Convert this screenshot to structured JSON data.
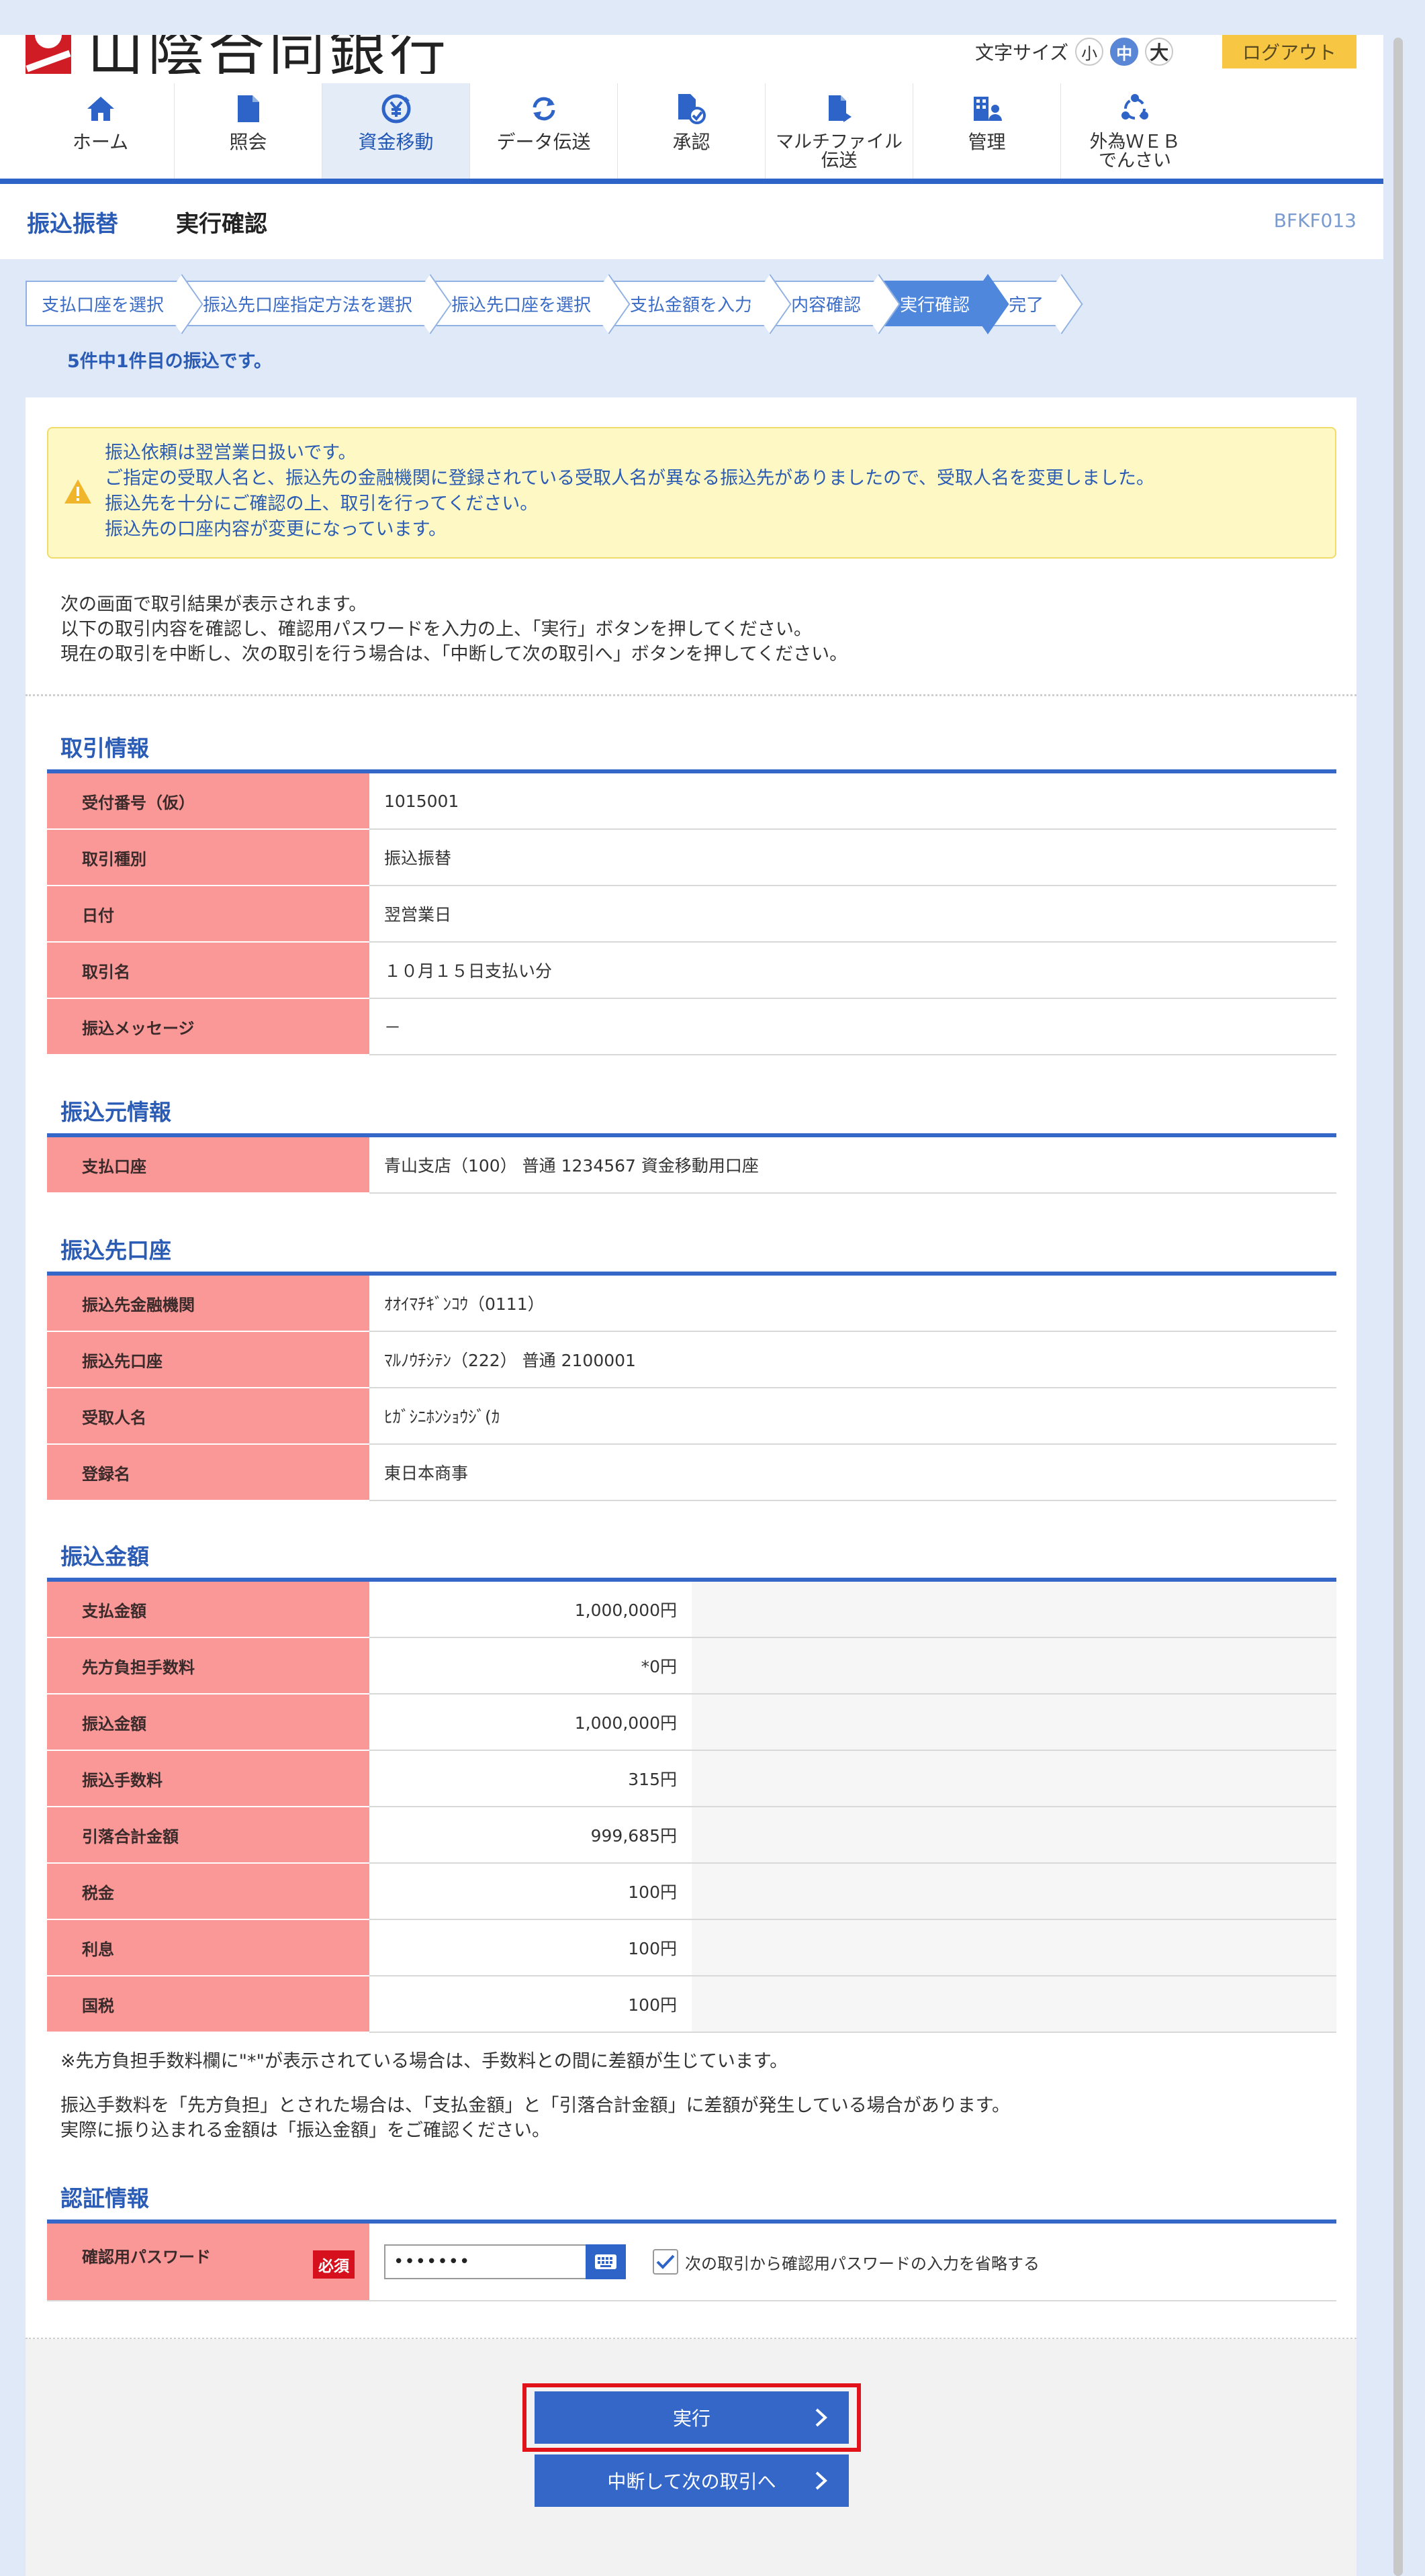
{
  "header": {
    "logo_text": "山陰合同銀行",
    "font_size_label": "文字サイズ",
    "font_sizes": [
      "小",
      "中",
      "大"
    ],
    "logout": "ログアウト"
  },
  "nav": [
    {
      "label": "ホーム",
      "icon": "home-icon"
    },
    {
      "label": "照会",
      "icon": "document-icon"
    },
    {
      "label": "資金移動",
      "icon": "yen-transfer-icon"
    },
    {
      "label": "データ伝送",
      "icon": "refresh-icon"
    },
    {
      "label": "承認",
      "icon": "approval-icon"
    },
    {
      "label": "マルチファイル\n伝送",
      "icon": "multi-file-icon"
    },
    {
      "label": "管理",
      "icon": "manage-icon"
    },
    {
      "label": "外為ＷＥＢ\nでんさい",
      "icon": "network-icon"
    }
  ],
  "title": {
    "main": "振込振替",
    "sub": "実行確認",
    "screen_id": "BFKF013"
  },
  "steps": [
    "支払口座を選択",
    "振込先口座指定方法を選択",
    "振込先口座を選択",
    "支払金額を入力",
    "内容確認",
    "実行確認",
    "完了"
  ],
  "progress_notice": "5件中1件目の振込です。",
  "alert": {
    "lines": [
      "振込依頼は翌営業日扱いです。",
      "ご指定の受取人名と、振込先の金融機関に登録されている受取人名が異なる振込先がありましたので、受取人名を変更しました。",
      "振込先を十分にご確認の上、取引を行ってください。",
      "振込先の口座内容が変更になっています。"
    ]
  },
  "intro": [
    "次の画面で取引結果が表示されます。",
    "以下の取引内容を確認し、確認用パスワードを入力の上、「実行」ボタンを押してください。",
    "現在の取引を中断し、次の取引を行う場合は、「中断して次の取引へ」ボタンを押してください。"
  ],
  "transaction": {
    "heading": "取引情報",
    "rows": [
      {
        "k": "受付番号（仮）",
        "v": "1015001"
      },
      {
        "k": "取引種別",
        "v": "振込振替"
      },
      {
        "k": "日付",
        "v": "翌営業日"
      },
      {
        "k": "取引名",
        "v": "１０月１５日支払い分"
      },
      {
        "k": "振込メッセージ",
        "v": "－"
      }
    ]
  },
  "source": {
    "heading": "振込元情報",
    "rows": [
      {
        "k": "支払口座",
        "v": "青山支店（100） 普通 1234567 資金移動用口座"
      }
    ]
  },
  "dest": {
    "heading": "振込先口座",
    "rows": [
      {
        "k": "振込先金融機関",
        "v": "ｵｵｲﾏﾁｷﾞﾝｺｳ（0111）"
      },
      {
        "k": "振込先口座",
        "v": "ﾏﾙﾉｳﾁｼﾃﾝ（222） 普通 2100001"
      },
      {
        "k": "受取人名",
        "v": "ﾋｶﾞｼﾆﾎﾝｼｮｳｼﾞ(ｶ"
      },
      {
        "k": "登録名",
        "v": "東日本商事"
      }
    ]
  },
  "amount": {
    "heading": "振込金額",
    "rows": [
      {
        "k": "支払金額",
        "v": "1,000,000円"
      },
      {
        "k": "先方負担手数料",
        "v": "*0円"
      },
      {
        "k": "振込金額",
        "v": "1,000,000円"
      },
      {
        "k": "振込手数料",
        "v": "315円"
      },
      {
        "k": "引落合計金額",
        "v": "999,685円"
      },
      {
        "k": "税金",
        "v": "100円"
      },
      {
        "k": "利息",
        "v": "100円"
      },
      {
        "k": "国税",
        "v": "100円"
      }
    ]
  },
  "notes": {
    "asterisk": "※先方負担手数料欄に\"*\"が表示されている場合は、手数料との間に差額が生じています。",
    "fee1": "振込手数料を「先方負担」とされた場合は、「支払金額」と「引落合計金額」に差額が発生している場合があります。",
    "fee2": "実際に振り込まれる金額は「振込金額」をご確認ください。"
  },
  "auth": {
    "heading": "認証情報",
    "password_label": "確認用パスワード",
    "required": "必須",
    "password_value": "•••••••",
    "skip_label": "次の取引から確認用パスワードの入力を省略する",
    "skip_checked": true
  },
  "buttons": {
    "execute": "実行",
    "interrupt": "中断して次の取引へ"
  },
  "colors": {
    "accent": "#2e63c8",
    "label_bg": "#fa9898",
    "alert_bg": "#fdf8c4",
    "logout_bg": "#f7c744",
    "highlight": "#e2121b"
  }
}
